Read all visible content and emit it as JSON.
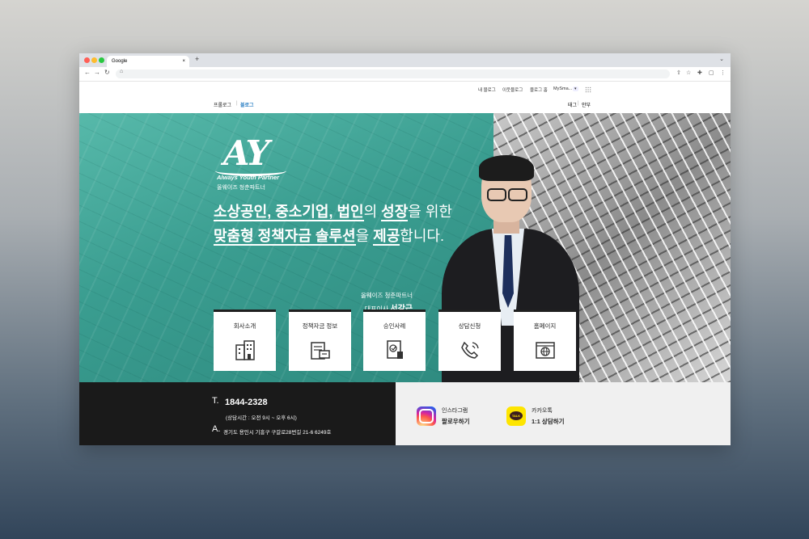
{
  "browser": {
    "tab_title": "Google",
    "tab_close": "×",
    "new_tab": "+",
    "tab_dropdown": "⌄",
    "nav_back": "←",
    "nav_forward": "→",
    "nav_reload": "↻",
    "lock_icon": "🔒",
    "right_icons": [
      "⇧",
      "☆",
      "✚",
      "▢",
      "⋮"
    ]
  },
  "topnav": {
    "my_blog": "내 블로그",
    "neighbor_blog": "이웃블로그",
    "blog_home": "블로그 홈",
    "mysma": "MySma..."
  },
  "subnav": {
    "profile": "프롤로그",
    "blog": "블로그",
    "tag": "태그",
    "guestbook": "안부"
  },
  "hero": {
    "logo_mark": "AY",
    "logo_en": "Always Youth Partner",
    "logo_ko": "올웨이즈 청춘파트너",
    "headline_line1_parts": [
      "소상공인, 중소기업, 법인",
      "의 ",
      "성장",
      "을 위한"
    ],
    "headline_line2_parts": [
      "맞춤형 정책자금 솔루션",
      "을 ",
      "제공",
      "합니다."
    ],
    "ceo_company": "올웨이즈 청춘파트너",
    "ceo_title": "대표이사",
    "ceo_name": "서강근"
  },
  "menu": [
    {
      "label": "회사소개",
      "icon": "building-icon"
    },
    {
      "label": "정책자금 정보",
      "icon": "document-screen-icon"
    },
    {
      "label": "승인사례",
      "icon": "certificate-icon"
    },
    {
      "label": "상담신청",
      "icon": "phone-icon"
    },
    {
      "label": "홈페이지",
      "icon": "web-browser-icon"
    }
  ],
  "footer": {
    "t_label": "T.",
    "phone": "1844-2328",
    "hours": "(상담시간 : 오전  9시 ~ 오후 6시)",
    "a_label": "A.",
    "address": "경기도 용인시 기흥구 구갈로28번길 21-6 6249호",
    "instagram_line1": "인스타그램",
    "instagram_line2": "팔로우하기",
    "kakao_bubble": "TALK",
    "kakao_line1": "카카오톡",
    "kakao_line2": "1:1 상담하기"
  },
  "colors": {
    "teal": "#43a598",
    "footer_dark": "#1a1a1a",
    "kakao_yellow": "#fee500",
    "blog_blue": "#2b7fc4"
  }
}
